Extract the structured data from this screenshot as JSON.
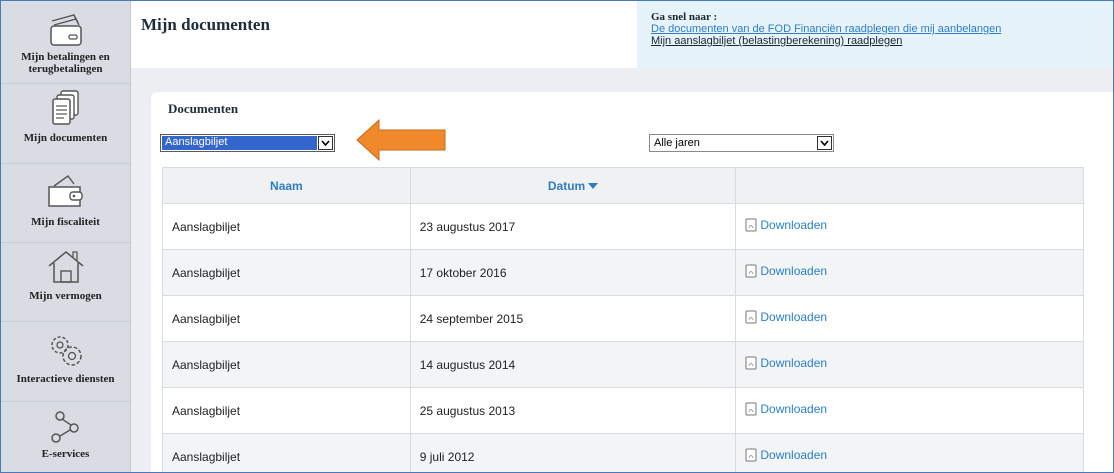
{
  "sidebar": {
    "items": [
      {
        "label": "Mijn betalingen en terugbetalingen",
        "icon": "wallet-card-icon"
      },
      {
        "label": "Mijn documenten",
        "icon": "documents-icon"
      },
      {
        "label": "Mijn fiscaliteit",
        "icon": "wallet-icon"
      },
      {
        "label": "Mijn vermogen",
        "icon": "house-icon"
      },
      {
        "label": "Interactieve diensten",
        "icon": "gears-icon"
      },
      {
        "label": "E-services",
        "icon": "share-nodes-icon"
      }
    ]
  },
  "header": {
    "title": "Mijn documenten"
  },
  "quicklinks": {
    "title": "Ga snel naar :",
    "link1": "De documenten van de FOD Financiën raadplegen die mij aanbelangen",
    "link2": "Mijn aanslagbiljet (belastingberekening) raadplegen"
  },
  "panel": {
    "title": "Documenten",
    "type_select": {
      "value": "Aanslagbiljet"
    },
    "year_select": {
      "value": "Alle jaren"
    }
  },
  "table": {
    "headers": {
      "name": "Naam",
      "date": "Datum",
      "action": ""
    },
    "rows": [
      {
        "name": "Aanslagbiljet",
        "date": "23 augustus 2017",
        "action": "Downloaden"
      },
      {
        "name": "Aanslagbiljet",
        "date": "17 oktober 2016",
        "action": "Downloaden"
      },
      {
        "name": "Aanslagbiljet",
        "date": "24 september 2015",
        "action": "Downloaden"
      },
      {
        "name": "Aanslagbiljet",
        "date": "14 augustus 2014",
        "action": "Downloaden"
      },
      {
        "name": "Aanslagbiljet",
        "date": "25 augustus 2013",
        "action": "Downloaden"
      },
      {
        "name": "Aanslagbiljet",
        "date": "9 juli 2012",
        "action": "Downloaden"
      }
    ]
  },
  "colors": {
    "accent": "#2a7fc8",
    "callout_arrow": "#f0892a",
    "selected": "#3366cc"
  }
}
